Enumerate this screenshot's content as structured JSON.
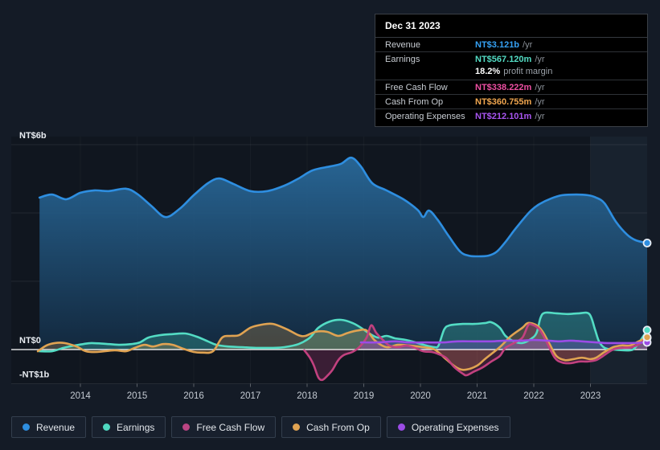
{
  "page": {
    "background": "#141b26"
  },
  "tooltip": {
    "date": "Dec 31 2023",
    "rows": [
      {
        "key": "revenue",
        "label": "Revenue",
        "value": "NT$3.121b",
        "suffix": "/yr",
        "color": "#36a2f5"
      },
      {
        "key": "earnings",
        "label": "Earnings",
        "value": "NT$567.120m",
        "suffix": "/yr",
        "color": "#53dcc4",
        "sub_value": "18.2%",
        "sub_text": "profit margin"
      },
      {
        "key": "free-cash-flow",
        "label": "Free Cash Flow",
        "value": "NT$338.222m",
        "suffix": "/yr",
        "color": "#ed4fa2"
      },
      {
        "key": "cash-from-op",
        "label": "Cash From Op",
        "value": "NT$360.755m",
        "suffix": "/yr",
        "color": "#f0a64f"
      },
      {
        "key": "operating-expenses",
        "label": "Operating Expenses",
        "value": "NT$212.101m",
        "suffix": "/yr",
        "color": "#a855f0"
      }
    ]
  },
  "legend": [
    {
      "key": "revenue",
      "label": "Revenue",
      "color": "#2e8ee0"
    },
    {
      "key": "earnings",
      "label": "Earnings",
      "color": "#4fd8c0"
    },
    {
      "key": "free-cash-flow",
      "label": "Free Cash Flow",
      "color": "#bb4583"
    },
    {
      "key": "cash-from-op",
      "label": "Cash From Op",
      "color": "#e0a352"
    },
    {
      "key": "operating-expenses",
      "label": "Operating Expenses",
      "color": "#9b4ce6"
    }
  ],
  "chart_data": {
    "type": "area",
    "title": "Financial history: revenue, earnings and cash flow (NT$, /yr)",
    "currency_unit": "NT$",
    "xlim": [
      2013.25,
      2024.0
    ],
    "ylim": [
      -1.0,
      6.2
    ],
    "grid": true,
    "legend_position": "bottom",
    "x_ticks": [
      2014,
      2015,
      2016,
      2017,
      2018,
      2019,
      2020,
      2021,
      2022,
      2023
    ],
    "y_ticks": [
      {
        "label": "NT$6b",
        "value": 6
      },
      {
        "label": "NT$0",
        "value": 0
      },
      {
        "label": "-NT$1b",
        "value": -1
      }
    ],
    "y_gridlines": [
      6,
      4,
      2,
      -1
    ],
    "highlight_band": {
      "start": 2023.0,
      "end": 2024.0
    },
    "series": [
      {
        "name": "Revenue",
        "color": "#2e8ee0",
        "fill": "gradient",
        "end_dot": true,
        "points": [
          [
            2013.28,
            4.45
          ],
          [
            2013.5,
            4.54
          ],
          [
            2013.75,
            4.4
          ],
          [
            2014.0,
            4.59
          ],
          [
            2014.25,
            4.66
          ],
          [
            2014.5,
            4.64
          ],
          [
            2014.8,
            4.71
          ],
          [
            2015.0,
            4.56
          ],
          [
            2015.25,
            4.21
          ],
          [
            2015.5,
            3.88
          ],
          [
            2015.75,
            4.12
          ],
          [
            2016.0,
            4.52
          ],
          [
            2016.25,
            4.87
          ],
          [
            2016.45,
            5.01
          ],
          [
            2016.7,
            4.85
          ],
          [
            2017.0,
            4.64
          ],
          [
            2017.3,
            4.64
          ],
          [
            2017.6,
            4.8
          ],
          [
            2017.85,
            5.01
          ],
          [
            2018.1,
            5.25
          ],
          [
            2018.4,
            5.36
          ],
          [
            2018.6,
            5.44
          ],
          [
            2018.78,
            5.62
          ],
          [
            2018.95,
            5.36
          ],
          [
            2019.15,
            4.87
          ],
          [
            2019.4,
            4.66
          ],
          [
            2019.7,
            4.4
          ],
          [
            2019.95,
            4.09
          ],
          [
            2020.05,
            3.88
          ],
          [
            2020.15,
            4.07
          ],
          [
            2020.3,
            3.81
          ],
          [
            2020.5,
            3.32
          ],
          [
            2020.7,
            2.87
          ],
          [
            2020.85,
            2.75
          ],
          [
            2021.0,
            2.73
          ],
          [
            2021.2,
            2.75
          ],
          [
            2021.35,
            2.87
          ],
          [
            2021.5,
            3.15
          ],
          [
            2021.65,
            3.48
          ],
          [
            2021.8,
            3.79
          ],
          [
            2021.95,
            4.07
          ],
          [
            2022.1,
            4.26
          ],
          [
            2022.3,
            4.42
          ],
          [
            2022.5,
            4.52
          ],
          [
            2022.75,
            4.54
          ],
          [
            2022.95,
            4.52
          ],
          [
            2023.1,
            4.45
          ],
          [
            2023.25,
            4.28
          ],
          [
            2023.45,
            3.74
          ],
          [
            2023.65,
            3.36
          ],
          [
            2023.8,
            3.2
          ],
          [
            2024.0,
            3.12
          ]
        ]
      },
      {
        "name": "Earnings",
        "color": "#53dcc4",
        "fill": "rgba(70,210,185,0.28)",
        "end_dot": true,
        "points": [
          [
            2013.28,
            -0.05
          ],
          [
            2013.5,
            -0.05
          ],
          [
            2013.7,
            0.05
          ],
          [
            2013.9,
            0.12
          ],
          [
            2014.05,
            0.16
          ],
          [
            2014.2,
            0.19
          ],
          [
            2014.5,
            0.16
          ],
          [
            2014.7,
            0.14
          ],
          [
            2014.9,
            0.16
          ],
          [
            2015.05,
            0.21
          ],
          [
            2015.2,
            0.35
          ],
          [
            2015.4,
            0.42
          ],
          [
            2015.6,
            0.45
          ],
          [
            2015.85,
            0.47
          ],
          [
            2016.05,
            0.38
          ],
          [
            2016.25,
            0.24
          ],
          [
            2016.4,
            0.14
          ],
          [
            2016.6,
            0.09
          ],
          [
            2016.85,
            0.07
          ],
          [
            2017.1,
            0.05
          ],
          [
            2017.4,
            0.05
          ],
          [
            2017.6,
            0.07
          ],
          [
            2017.85,
            0.16
          ],
          [
            2018.05,
            0.35
          ],
          [
            2018.2,
            0.64
          ],
          [
            2018.4,
            0.82
          ],
          [
            2018.6,
            0.87
          ],
          [
            2018.8,
            0.78
          ],
          [
            2018.95,
            0.64
          ],
          [
            2019.1,
            0.47
          ],
          [
            2019.25,
            0.35
          ],
          [
            2019.4,
            0.4
          ],
          [
            2019.55,
            0.33
          ],
          [
            2019.75,
            0.28
          ],
          [
            2019.95,
            0.19
          ],
          [
            2020.1,
            0.12
          ],
          [
            2020.25,
            0.07
          ],
          [
            2020.32,
            0.12
          ],
          [
            2020.42,
            0.59
          ],
          [
            2020.52,
            0.71
          ],
          [
            2020.75,
            0.75
          ],
          [
            2020.95,
            0.75
          ],
          [
            2021.15,
            0.78
          ],
          [
            2021.25,
            0.8
          ],
          [
            2021.4,
            0.64
          ],
          [
            2021.5,
            0.4
          ],
          [
            2021.65,
            0.24
          ],
          [
            2021.8,
            0.19
          ],
          [
            2021.95,
            0.31
          ],
          [
            2022.05,
            0.49
          ],
          [
            2022.12,
            0.94
          ],
          [
            2022.2,
            1.08
          ],
          [
            2022.4,
            1.06
          ],
          [
            2022.6,
            1.04
          ],
          [
            2022.8,
            1.06
          ],
          [
            2022.98,
            1.04
          ],
          [
            2023.08,
            0.59
          ],
          [
            2023.15,
            0.24
          ],
          [
            2023.25,
            0.05
          ],
          [
            2023.4,
            0.0
          ],
          [
            2023.6,
            -0.02
          ],
          [
            2023.75,
            0.0
          ],
          [
            2023.87,
            0.24
          ],
          [
            2024.0,
            0.57
          ]
        ]
      },
      {
        "name": "Cash From Op",
        "color": "#e0a352",
        "fill": "rgba(215,155,75,0.26)",
        "end_dot": true,
        "points": [
          [
            2013.25,
            -0.05
          ],
          [
            2013.4,
            0.12
          ],
          [
            2013.55,
            0.19
          ],
          [
            2013.72,
            0.19
          ],
          [
            2013.93,
            0.09
          ],
          [
            2014.1,
            -0.05
          ],
          [
            2014.3,
            -0.07
          ],
          [
            2014.6,
            -0.02
          ],
          [
            2014.8,
            -0.05
          ],
          [
            2014.96,
            0.05
          ],
          [
            2015.13,
            0.14
          ],
          [
            2015.28,
            0.09
          ],
          [
            2015.46,
            0.16
          ],
          [
            2015.63,
            0.14
          ],
          [
            2015.82,
            0.02
          ],
          [
            2016.0,
            -0.07
          ],
          [
            2016.16,
            -0.09
          ],
          [
            2016.34,
            -0.05
          ],
          [
            2016.5,
            0.35
          ],
          [
            2016.65,
            0.4
          ],
          [
            2016.8,
            0.42
          ],
          [
            2017.0,
            0.64
          ],
          [
            2017.2,
            0.73
          ],
          [
            2017.4,
            0.75
          ],
          [
            2017.65,
            0.59
          ],
          [
            2017.85,
            0.42
          ],
          [
            2017.97,
            0.4
          ],
          [
            2018.15,
            0.52
          ],
          [
            2018.35,
            0.52
          ],
          [
            2018.55,
            0.4
          ],
          [
            2018.72,
            0.49
          ],
          [
            2018.9,
            0.56
          ],
          [
            2019.05,
            0.56
          ],
          [
            2019.2,
            0.26
          ],
          [
            2019.4,
            0.07
          ],
          [
            2019.6,
            0.14
          ],
          [
            2019.8,
            0.12
          ],
          [
            2020.05,
            0.07
          ],
          [
            2020.25,
            0.0
          ],
          [
            2020.45,
            -0.28
          ],
          [
            2020.65,
            -0.54
          ],
          [
            2020.8,
            -0.59
          ],
          [
            2021.0,
            -0.47
          ],
          [
            2021.15,
            -0.26
          ],
          [
            2021.4,
            0.07
          ],
          [
            2021.6,
            0.4
          ],
          [
            2021.8,
            0.64
          ],
          [
            2021.9,
            0.78
          ],
          [
            2022.05,
            0.71
          ],
          [
            2022.15,
            0.54
          ],
          [
            2022.27,
            0.19
          ],
          [
            2022.4,
            -0.19
          ],
          [
            2022.55,
            -0.31
          ],
          [
            2022.7,
            -0.28
          ],
          [
            2022.85,
            -0.24
          ],
          [
            2023.0,
            -0.28
          ],
          [
            2023.1,
            -0.24
          ],
          [
            2023.25,
            -0.07
          ],
          [
            2023.4,
            0.07
          ],
          [
            2023.55,
            0.12
          ],
          [
            2023.7,
            0.12
          ],
          [
            2023.85,
            0.24
          ],
          [
            2024.0,
            0.36
          ]
        ]
      },
      {
        "name": "Free Cash Flow",
        "color": "#c2417f",
        "fill": "rgba(180,55,115,0.26)",
        "end_dot": true,
        "points": [
          [
            2017.95,
            -0.02
          ],
          [
            2018.05,
            -0.24
          ],
          [
            2018.12,
            -0.47
          ],
          [
            2018.2,
            -0.82
          ],
          [
            2018.27,
            -0.89
          ],
          [
            2018.35,
            -0.78
          ],
          [
            2018.45,
            -0.59
          ],
          [
            2018.55,
            -0.31
          ],
          [
            2018.65,
            -0.16
          ],
          [
            2018.8,
            -0.07
          ],
          [
            2018.92,
            0.07
          ],
          [
            2019.05,
            0.35
          ],
          [
            2019.13,
            0.71
          ],
          [
            2019.22,
            0.49
          ],
          [
            2019.32,
            0.31
          ],
          [
            2019.45,
            0.12
          ],
          [
            2019.6,
            0.07
          ],
          [
            2019.75,
            0.12
          ],
          [
            2019.9,
            0.05
          ],
          [
            2020.05,
            -0.05
          ],
          [
            2020.2,
            -0.07
          ],
          [
            2020.3,
            -0.12
          ],
          [
            2020.45,
            -0.24
          ],
          [
            2020.6,
            -0.52
          ],
          [
            2020.75,
            -0.71
          ],
          [
            2020.82,
            -0.75
          ],
          [
            2020.95,
            -0.64
          ],
          [
            2021.1,
            -0.52
          ],
          [
            2021.25,
            -0.35
          ],
          [
            2021.4,
            -0.19
          ],
          [
            2021.5,
            0.05
          ],
          [
            2021.65,
            0.19
          ],
          [
            2021.8,
            0.35
          ],
          [
            2021.9,
            0.71
          ],
          [
            2021.97,
            0.73
          ],
          [
            2022.1,
            0.59
          ],
          [
            2022.22,
            0.24
          ],
          [
            2022.37,
            -0.24
          ],
          [
            2022.5,
            -0.38
          ],
          [
            2022.65,
            -0.4
          ],
          [
            2022.8,
            -0.35
          ],
          [
            2022.95,
            -0.35
          ],
          [
            2023.1,
            -0.31
          ],
          [
            2023.22,
            -0.19
          ],
          [
            2023.4,
            0.0
          ],
          [
            2023.57,
            0.05
          ],
          [
            2023.72,
            0.07
          ],
          [
            2023.86,
            0.16
          ],
          [
            2024.0,
            0.34
          ]
        ]
      },
      {
        "name": "Operating Expenses",
        "color": "#9b4ce6",
        "fill": "rgba(150,80,230,0.26)",
        "end_dot": true,
        "points": [
          [
            2018.95,
            0.21
          ],
          [
            2019.25,
            0.21
          ],
          [
            2019.55,
            0.24
          ],
          [
            2019.8,
            0.21
          ],
          [
            2020.1,
            0.21
          ],
          [
            2020.4,
            0.21
          ],
          [
            2020.65,
            0.24
          ],
          [
            2020.95,
            0.24
          ],
          [
            2021.25,
            0.24
          ],
          [
            2021.5,
            0.26
          ],
          [
            2021.8,
            0.26
          ],
          [
            2022.0,
            0.28
          ],
          [
            2022.25,
            0.26
          ],
          [
            2022.45,
            0.24
          ],
          [
            2022.65,
            0.26
          ],
          [
            2022.85,
            0.24
          ],
          [
            2023.1,
            0.21
          ],
          [
            2023.3,
            0.19
          ],
          [
            2023.5,
            0.19
          ],
          [
            2023.7,
            0.19
          ],
          [
            2024.0,
            0.21
          ]
        ]
      }
    ]
  }
}
